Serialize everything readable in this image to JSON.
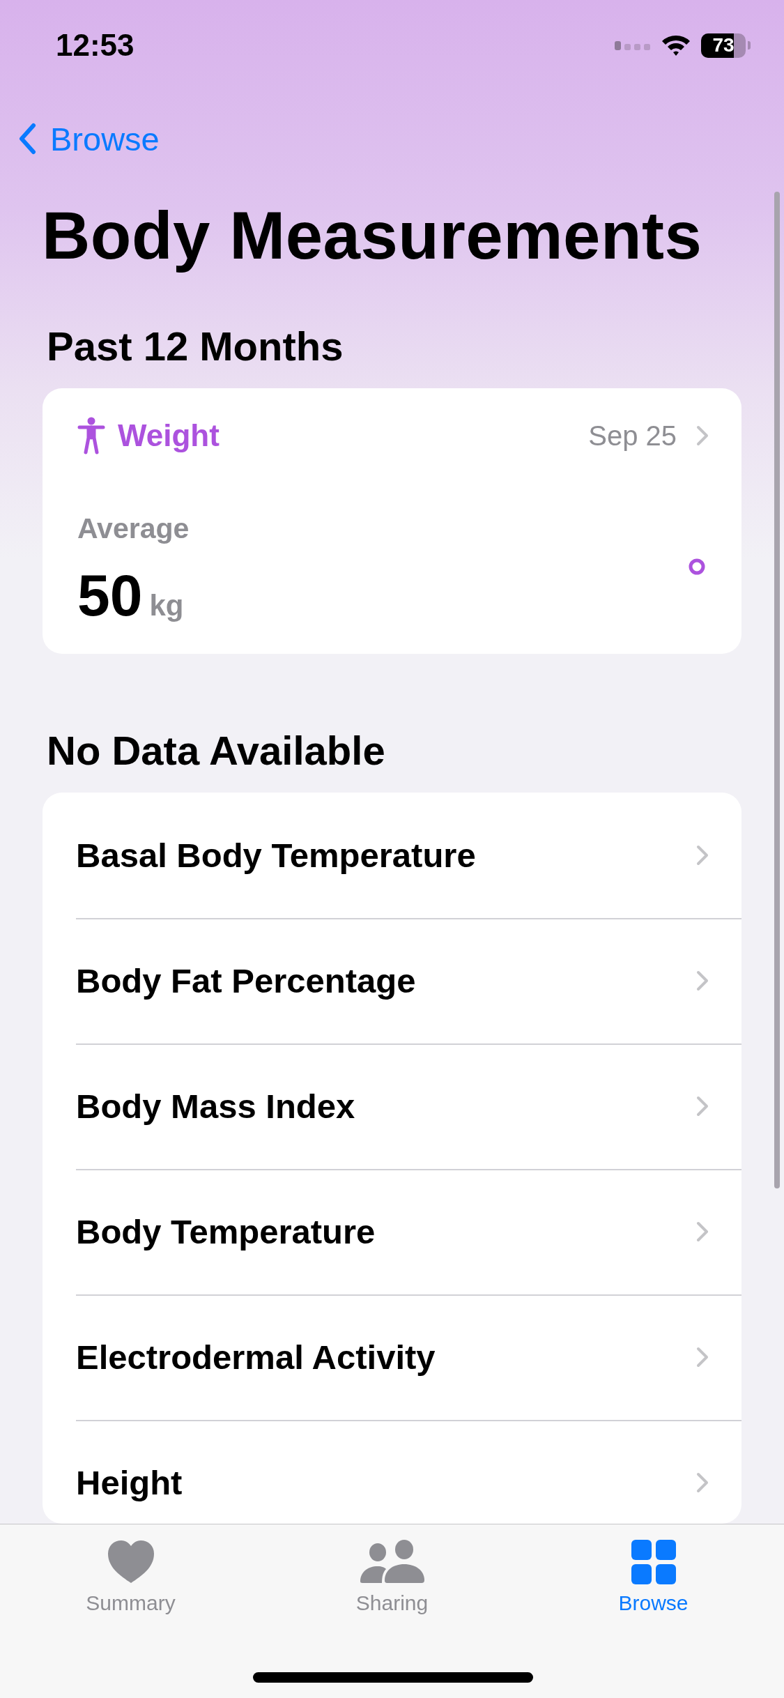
{
  "status_bar": {
    "time": "12:53",
    "battery": "73"
  },
  "nav": {
    "back": "Browse"
  },
  "title": "Body Measurements",
  "recent": {
    "heading": "Past 12 Months",
    "card": {
      "name": "Weight",
      "date": "Sep 25",
      "label": "Average",
      "value": "50",
      "unit": "kg"
    }
  },
  "no_data": {
    "heading": "No Data Available",
    "items": [
      {
        "label": "Basal Body Temperature"
      },
      {
        "label": "Body Fat Percentage"
      },
      {
        "label": "Body Mass Index"
      },
      {
        "label": "Body Temperature"
      },
      {
        "label": "Electrodermal Activity"
      },
      {
        "label": "Height"
      }
    ]
  },
  "tabs": [
    {
      "label": "Summary",
      "kind": "heart",
      "selected": false
    },
    {
      "label": "Sharing",
      "kind": "people",
      "selected": false
    },
    {
      "label": "Browse",
      "kind": "grid",
      "selected": true
    }
  ]
}
